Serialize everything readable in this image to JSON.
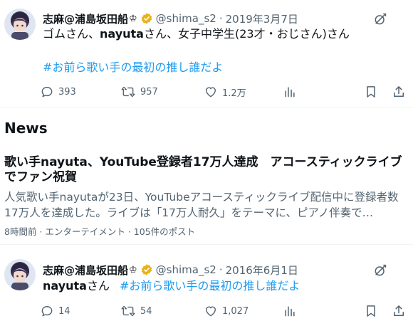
{
  "colors": {
    "accent": "#1d9bf0",
    "text": "#0f1419",
    "muted": "#536471",
    "divider": "#eff3f4",
    "verified_gold": "#e8b21a"
  },
  "tweets": [
    {
      "author_name": "志麻@浦島坂田船",
      "crown": "♔",
      "handle": "@shima_s2",
      "separator": "·",
      "date": "2019年3月7日",
      "text_part1": "ゴムさん、",
      "text_bold": "nayuta",
      "text_part2": "さん、女子中学生(23才・おじさん)さん",
      "hashtag": "#お前ら歌い手の最初の推し誰だよ",
      "replies": "393",
      "retweets": "957",
      "likes": "1.2万",
      "icons": [
        "verified-badge-icon",
        "grok-icon",
        "reply-icon",
        "retweet-icon",
        "like-icon",
        "views-icon",
        "bookmark-icon",
        "share-icon"
      ]
    },
    {
      "author_name": "志麻@浦島坂田船",
      "crown": "♔",
      "handle": "@shima_s2",
      "separator": "·",
      "date": "2016年6月1日",
      "text_bold": "nayuta",
      "text_part2": "さん",
      "hashtag": "#お前ら歌い手の最初の推し誰だよ",
      "replies": "14",
      "retweets": "54",
      "likes": "1,027"
    }
  ],
  "news": {
    "section_title": "News",
    "headline": "歌い手nayuta、YouTube登録者17万人達成　アコースティックライブでファン祝賀",
    "summary": "人気歌い手nayutaが23日、YouTubeアコースティックライブ配信中に登録者数17万人を達成した。ライブは「17万人耐久」をテーマに、ピアノ伴奏で…",
    "meta": "8時間前 · エンターテイメント · 105件のポスト"
  }
}
